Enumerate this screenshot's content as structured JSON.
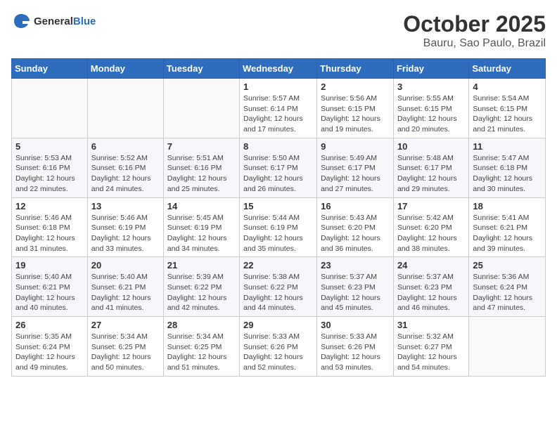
{
  "logo": {
    "text_general": "General",
    "text_blue": "Blue"
  },
  "title": "October 2025",
  "subtitle": "Bauru, Sao Paulo, Brazil",
  "days_of_week": [
    "Sunday",
    "Monday",
    "Tuesday",
    "Wednesday",
    "Thursday",
    "Friday",
    "Saturday"
  ],
  "weeks": [
    [
      {
        "day": "",
        "info": ""
      },
      {
        "day": "",
        "info": ""
      },
      {
        "day": "",
        "info": ""
      },
      {
        "day": "1",
        "info": "Sunrise: 5:57 AM\nSunset: 6:14 PM\nDaylight: 12 hours\nand 17 minutes."
      },
      {
        "day": "2",
        "info": "Sunrise: 5:56 AM\nSunset: 6:15 PM\nDaylight: 12 hours\nand 19 minutes."
      },
      {
        "day": "3",
        "info": "Sunrise: 5:55 AM\nSunset: 6:15 PM\nDaylight: 12 hours\nand 20 minutes."
      },
      {
        "day": "4",
        "info": "Sunrise: 5:54 AM\nSunset: 6:15 PM\nDaylight: 12 hours\nand 21 minutes."
      }
    ],
    [
      {
        "day": "5",
        "info": "Sunrise: 5:53 AM\nSunset: 6:16 PM\nDaylight: 12 hours\nand 22 minutes."
      },
      {
        "day": "6",
        "info": "Sunrise: 5:52 AM\nSunset: 6:16 PM\nDaylight: 12 hours\nand 24 minutes."
      },
      {
        "day": "7",
        "info": "Sunrise: 5:51 AM\nSunset: 6:16 PM\nDaylight: 12 hours\nand 25 minutes."
      },
      {
        "day": "8",
        "info": "Sunrise: 5:50 AM\nSunset: 6:17 PM\nDaylight: 12 hours\nand 26 minutes."
      },
      {
        "day": "9",
        "info": "Sunrise: 5:49 AM\nSunset: 6:17 PM\nDaylight: 12 hours\nand 27 minutes."
      },
      {
        "day": "10",
        "info": "Sunrise: 5:48 AM\nSunset: 6:17 PM\nDaylight: 12 hours\nand 29 minutes."
      },
      {
        "day": "11",
        "info": "Sunrise: 5:47 AM\nSunset: 6:18 PM\nDaylight: 12 hours\nand 30 minutes."
      }
    ],
    [
      {
        "day": "12",
        "info": "Sunrise: 5:46 AM\nSunset: 6:18 PM\nDaylight: 12 hours\nand 31 minutes."
      },
      {
        "day": "13",
        "info": "Sunrise: 5:46 AM\nSunset: 6:19 PM\nDaylight: 12 hours\nand 33 minutes."
      },
      {
        "day": "14",
        "info": "Sunrise: 5:45 AM\nSunset: 6:19 PM\nDaylight: 12 hours\nand 34 minutes."
      },
      {
        "day": "15",
        "info": "Sunrise: 5:44 AM\nSunset: 6:19 PM\nDaylight: 12 hours\nand 35 minutes."
      },
      {
        "day": "16",
        "info": "Sunrise: 5:43 AM\nSunset: 6:20 PM\nDaylight: 12 hours\nand 36 minutes."
      },
      {
        "day": "17",
        "info": "Sunrise: 5:42 AM\nSunset: 6:20 PM\nDaylight: 12 hours\nand 38 minutes."
      },
      {
        "day": "18",
        "info": "Sunrise: 5:41 AM\nSunset: 6:21 PM\nDaylight: 12 hours\nand 39 minutes."
      }
    ],
    [
      {
        "day": "19",
        "info": "Sunrise: 5:40 AM\nSunset: 6:21 PM\nDaylight: 12 hours\nand 40 minutes."
      },
      {
        "day": "20",
        "info": "Sunrise: 5:40 AM\nSunset: 6:21 PM\nDaylight: 12 hours\nand 41 minutes."
      },
      {
        "day": "21",
        "info": "Sunrise: 5:39 AM\nSunset: 6:22 PM\nDaylight: 12 hours\nand 42 minutes."
      },
      {
        "day": "22",
        "info": "Sunrise: 5:38 AM\nSunset: 6:22 PM\nDaylight: 12 hours\nand 44 minutes."
      },
      {
        "day": "23",
        "info": "Sunrise: 5:37 AM\nSunset: 6:23 PM\nDaylight: 12 hours\nand 45 minutes."
      },
      {
        "day": "24",
        "info": "Sunrise: 5:37 AM\nSunset: 6:23 PM\nDaylight: 12 hours\nand 46 minutes."
      },
      {
        "day": "25",
        "info": "Sunrise: 5:36 AM\nSunset: 6:24 PM\nDaylight: 12 hours\nand 47 minutes."
      }
    ],
    [
      {
        "day": "26",
        "info": "Sunrise: 5:35 AM\nSunset: 6:24 PM\nDaylight: 12 hours\nand 49 minutes."
      },
      {
        "day": "27",
        "info": "Sunrise: 5:34 AM\nSunset: 6:25 PM\nDaylight: 12 hours\nand 50 minutes."
      },
      {
        "day": "28",
        "info": "Sunrise: 5:34 AM\nSunset: 6:25 PM\nDaylight: 12 hours\nand 51 minutes."
      },
      {
        "day": "29",
        "info": "Sunrise: 5:33 AM\nSunset: 6:26 PM\nDaylight: 12 hours\nand 52 minutes."
      },
      {
        "day": "30",
        "info": "Sunrise: 5:33 AM\nSunset: 6:26 PM\nDaylight: 12 hours\nand 53 minutes."
      },
      {
        "day": "31",
        "info": "Sunrise: 5:32 AM\nSunset: 6:27 PM\nDaylight: 12 hours\nand 54 minutes."
      },
      {
        "day": "",
        "info": ""
      }
    ]
  ]
}
